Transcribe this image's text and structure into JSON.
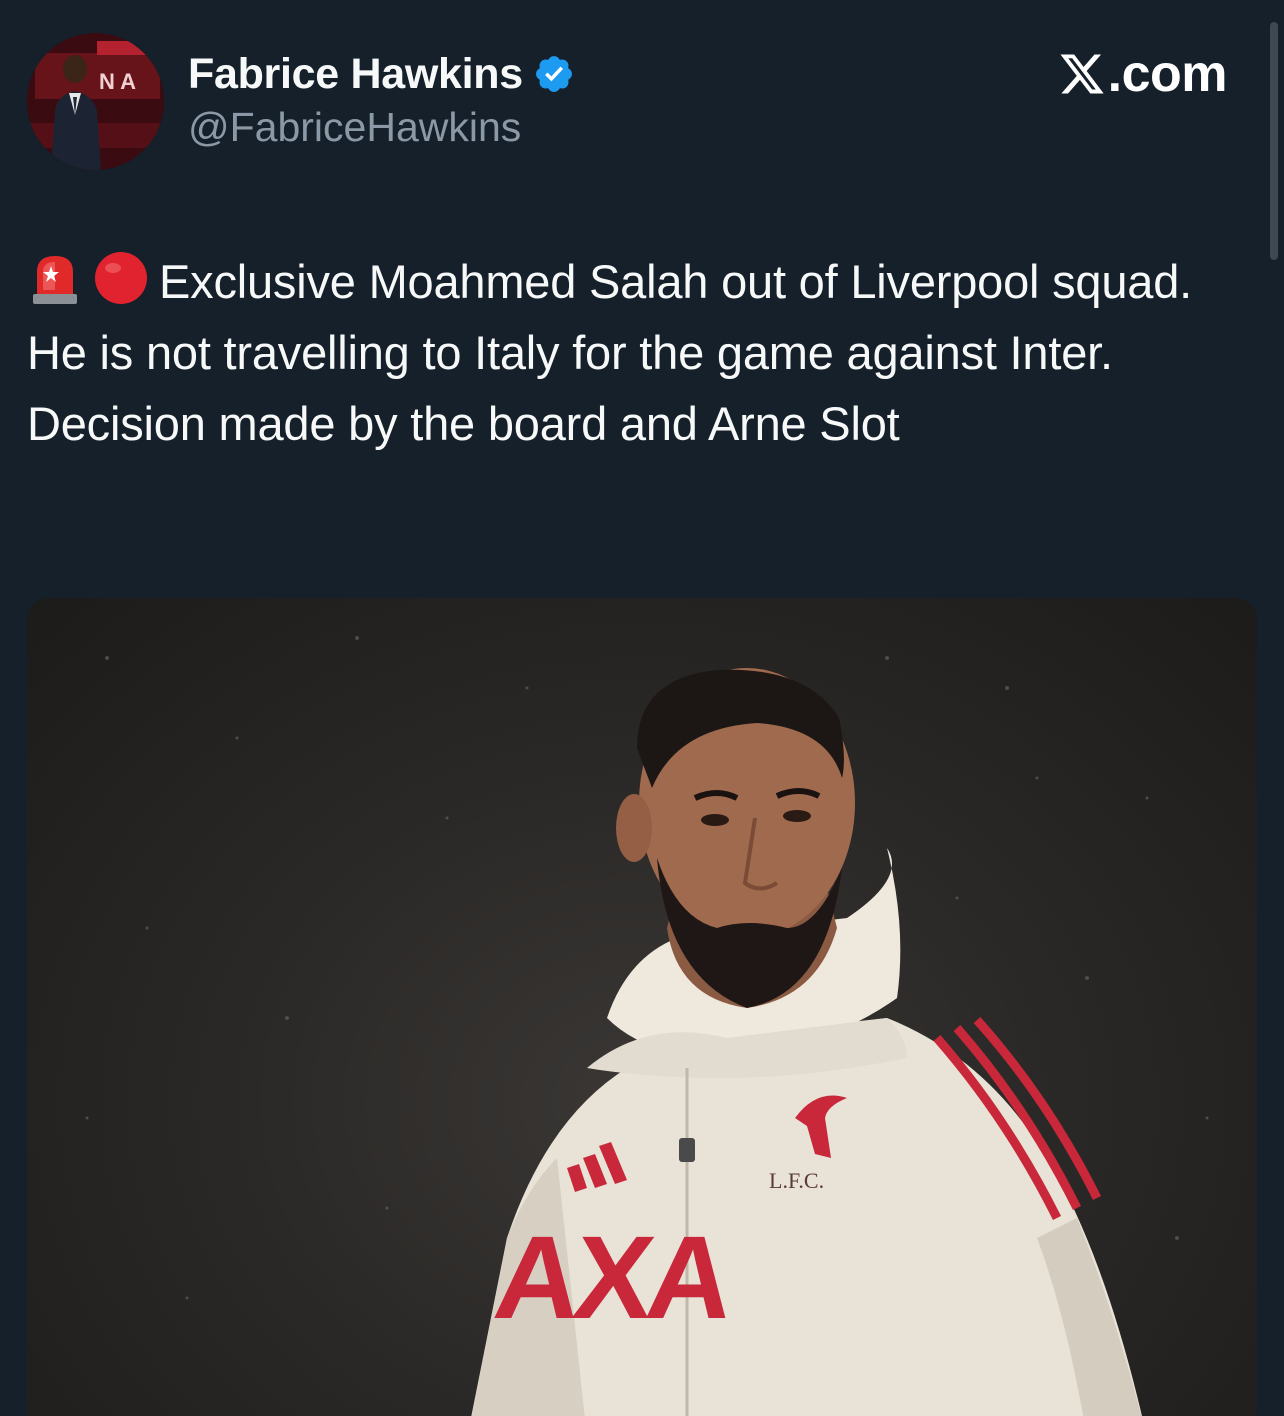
{
  "author": {
    "display_name": "Fabrice Hawkins",
    "handle": "@FabriceHawkins",
    "verified": true
  },
  "brand": {
    "label": ".com"
  },
  "tweet": {
    "emojis": [
      "police-light-emoji",
      "red-circle-emoji"
    ],
    "text": "Exclusive Moahmed Salah out of Liverpool squad. He is not travelling to Italy for the game against Inter. Decision made by the board and Arne Slot"
  },
  "media": {
    "type": "photo",
    "shirt_sponsor": "AXA",
    "crest_text": "L.F.C."
  },
  "colors": {
    "background": "#15202b",
    "text_primary": "#f7f9f9",
    "text_secondary": "#8b98a5",
    "verified_blue": "#1d9bf0",
    "kit_red": "#c8283a"
  }
}
